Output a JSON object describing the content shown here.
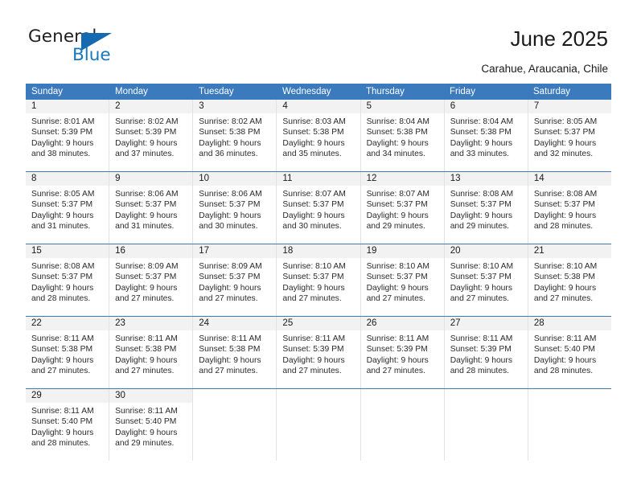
{
  "brand": {
    "name_part1": "General",
    "name_part2": "Blue",
    "accent_color": "#1569b0"
  },
  "header": {
    "title": "June 2025",
    "subtitle": "Carahue, Araucania, Chile"
  },
  "calendar": {
    "header_bg": "#3a7abd",
    "weekdays": [
      "Sunday",
      "Monday",
      "Tuesday",
      "Wednesday",
      "Thursday",
      "Friday",
      "Saturday"
    ],
    "weeks": [
      [
        {
          "day": "1",
          "sunrise": "Sunrise: 8:01 AM",
          "sunset": "Sunset: 5:39 PM",
          "daylight1": "Daylight: 9 hours",
          "daylight2": "and 38 minutes."
        },
        {
          "day": "2",
          "sunrise": "Sunrise: 8:02 AM",
          "sunset": "Sunset: 5:39 PM",
          "daylight1": "Daylight: 9 hours",
          "daylight2": "and 37 minutes."
        },
        {
          "day": "3",
          "sunrise": "Sunrise: 8:02 AM",
          "sunset": "Sunset: 5:38 PM",
          "daylight1": "Daylight: 9 hours",
          "daylight2": "and 36 minutes."
        },
        {
          "day": "4",
          "sunrise": "Sunrise: 8:03 AM",
          "sunset": "Sunset: 5:38 PM",
          "daylight1": "Daylight: 9 hours",
          "daylight2": "and 35 minutes."
        },
        {
          "day": "5",
          "sunrise": "Sunrise: 8:04 AM",
          "sunset": "Sunset: 5:38 PM",
          "daylight1": "Daylight: 9 hours",
          "daylight2": "and 34 minutes."
        },
        {
          "day": "6",
          "sunrise": "Sunrise: 8:04 AM",
          "sunset": "Sunset: 5:38 PM",
          "daylight1": "Daylight: 9 hours",
          "daylight2": "and 33 minutes."
        },
        {
          "day": "7",
          "sunrise": "Sunrise: 8:05 AM",
          "sunset": "Sunset: 5:37 PM",
          "daylight1": "Daylight: 9 hours",
          "daylight2": "and 32 minutes."
        }
      ],
      [
        {
          "day": "8",
          "sunrise": "Sunrise: 8:05 AM",
          "sunset": "Sunset: 5:37 PM",
          "daylight1": "Daylight: 9 hours",
          "daylight2": "and 31 minutes."
        },
        {
          "day": "9",
          "sunrise": "Sunrise: 8:06 AM",
          "sunset": "Sunset: 5:37 PM",
          "daylight1": "Daylight: 9 hours",
          "daylight2": "and 31 minutes."
        },
        {
          "day": "10",
          "sunrise": "Sunrise: 8:06 AM",
          "sunset": "Sunset: 5:37 PM",
          "daylight1": "Daylight: 9 hours",
          "daylight2": "and 30 minutes."
        },
        {
          "day": "11",
          "sunrise": "Sunrise: 8:07 AM",
          "sunset": "Sunset: 5:37 PM",
          "daylight1": "Daylight: 9 hours",
          "daylight2": "and 30 minutes."
        },
        {
          "day": "12",
          "sunrise": "Sunrise: 8:07 AM",
          "sunset": "Sunset: 5:37 PM",
          "daylight1": "Daylight: 9 hours",
          "daylight2": "and 29 minutes."
        },
        {
          "day": "13",
          "sunrise": "Sunrise: 8:08 AM",
          "sunset": "Sunset: 5:37 PM",
          "daylight1": "Daylight: 9 hours",
          "daylight2": "and 29 minutes."
        },
        {
          "day": "14",
          "sunrise": "Sunrise: 8:08 AM",
          "sunset": "Sunset: 5:37 PM",
          "daylight1": "Daylight: 9 hours",
          "daylight2": "and 28 minutes."
        }
      ],
      [
        {
          "day": "15",
          "sunrise": "Sunrise: 8:08 AM",
          "sunset": "Sunset: 5:37 PM",
          "daylight1": "Daylight: 9 hours",
          "daylight2": "and 28 minutes."
        },
        {
          "day": "16",
          "sunrise": "Sunrise: 8:09 AM",
          "sunset": "Sunset: 5:37 PM",
          "daylight1": "Daylight: 9 hours",
          "daylight2": "and 27 minutes."
        },
        {
          "day": "17",
          "sunrise": "Sunrise: 8:09 AM",
          "sunset": "Sunset: 5:37 PM",
          "daylight1": "Daylight: 9 hours",
          "daylight2": "and 27 minutes."
        },
        {
          "day": "18",
          "sunrise": "Sunrise: 8:10 AM",
          "sunset": "Sunset: 5:37 PM",
          "daylight1": "Daylight: 9 hours",
          "daylight2": "and 27 minutes."
        },
        {
          "day": "19",
          "sunrise": "Sunrise: 8:10 AM",
          "sunset": "Sunset: 5:37 PM",
          "daylight1": "Daylight: 9 hours",
          "daylight2": "and 27 minutes."
        },
        {
          "day": "20",
          "sunrise": "Sunrise: 8:10 AM",
          "sunset": "Sunset: 5:37 PM",
          "daylight1": "Daylight: 9 hours",
          "daylight2": "and 27 minutes."
        },
        {
          "day": "21",
          "sunrise": "Sunrise: 8:10 AM",
          "sunset": "Sunset: 5:38 PM",
          "daylight1": "Daylight: 9 hours",
          "daylight2": "and 27 minutes."
        }
      ],
      [
        {
          "day": "22",
          "sunrise": "Sunrise: 8:11 AM",
          "sunset": "Sunset: 5:38 PM",
          "daylight1": "Daylight: 9 hours",
          "daylight2": "and 27 minutes."
        },
        {
          "day": "23",
          "sunrise": "Sunrise: 8:11 AM",
          "sunset": "Sunset: 5:38 PM",
          "daylight1": "Daylight: 9 hours",
          "daylight2": "and 27 minutes."
        },
        {
          "day": "24",
          "sunrise": "Sunrise: 8:11 AM",
          "sunset": "Sunset: 5:38 PM",
          "daylight1": "Daylight: 9 hours",
          "daylight2": "and 27 minutes."
        },
        {
          "day": "25",
          "sunrise": "Sunrise: 8:11 AM",
          "sunset": "Sunset: 5:39 PM",
          "daylight1": "Daylight: 9 hours",
          "daylight2": "and 27 minutes."
        },
        {
          "day": "26",
          "sunrise": "Sunrise: 8:11 AM",
          "sunset": "Sunset: 5:39 PM",
          "daylight1": "Daylight: 9 hours",
          "daylight2": "and 27 minutes."
        },
        {
          "day": "27",
          "sunrise": "Sunrise: 8:11 AM",
          "sunset": "Sunset: 5:39 PM",
          "daylight1": "Daylight: 9 hours",
          "daylight2": "and 28 minutes."
        },
        {
          "day": "28",
          "sunrise": "Sunrise: 8:11 AM",
          "sunset": "Sunset: 5:40 PM",
          "daylight1": "Daylight: 9 hours",
          "daylight2": "and 28 minutes."
        }
      ],
      [
        {
          "day": "29",
          "sunrise": "Sunrise: 8:11 AM",
          "sunset": "Sunset: 5:40 PM",
          "daylight1": "Daylight: 9 hours",
          "daylight2": "and 28 minutes."
        },
        {
          "day": "30",
          "sunrise": "Sunrise: 8:11 AM",
          "sunset": "Sunset: 5:40 PM",
          "daylight1": "Daylight: 9 hours",
          "daylight2": "and 29 minutes."
        },
        {
          "day": "",
          "sunrise": "",
          "sunset": "",
          "daylight1": "",
          "daylight2": ""
        },
        {
          "day": "",
          "sunrise": "",
          "sunset": "",
          "daylight1": "",
          "daylight2": ""
        },
        {
          "day": "",
          "sunrise": "",
          "sunset": "",
          "daylight1": "",
          "daylight2": ""
        },
        {
          "day": "",
          "sunrise": "",
          "sunset": "",
          "daylight1": "",
          "daylight2": ""
        },
        {
          "day": "",
          "sunrise": "",
          "sunset": "",
          "daylight1": "",
          "daylight2": ""
        }
      ]
    ]
  }
}
